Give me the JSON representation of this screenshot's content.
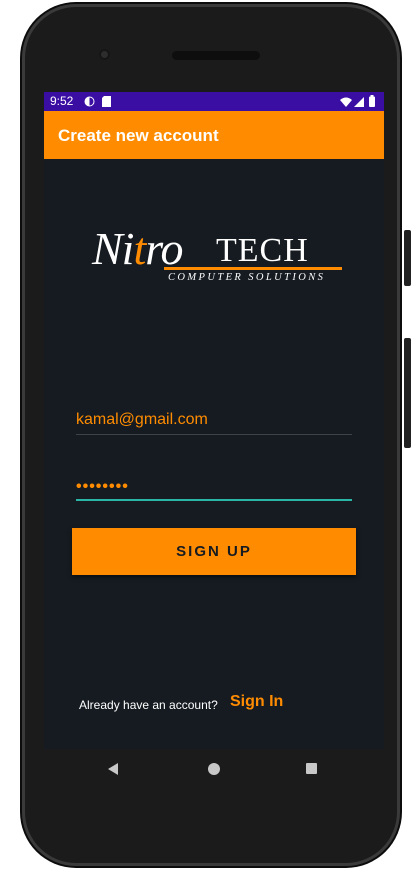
{
  "status_bar": {
    "time": "9:52",
    "icons": [
      "data-saver-icon",
      "sd-card-icon",
      "wifi-icon",
      "signal-icon",
      "battery-icon"
    ]
  },
  "app_bar": {
    "title": "Create new account"
  },
  "logo": {
    "name_part1": "Ni",
    "name_part2": "t",
    "name_part3": "ro",
    "name_part4": "TECH",
    "tagline": "COMPUTER SOLUTIONS"
  },
  "form": {
    "email_value": "kamal@gmail.com",
    "password_value": "••••••••",
    "signup_label": "SIGN UP"
  },
  "footer": {
    "prompt": "Already have an account?",
    "signin_label": "Sign In"
  },
  "nav": {
    "icons": [
      "back-icon",
      "home-icon",
      "recents-icon"
    ]
  },
  "colors": {
    "accent": "#ff8c00",
    "background": "#151b21",
    "status_bar": "#3a0ea3",
    "focus_line": "#2bb5a6"
  }
}
